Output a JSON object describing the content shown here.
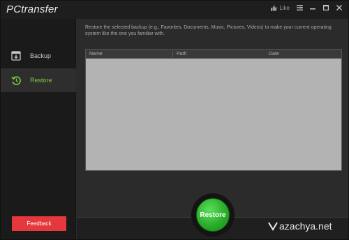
{
  "app": {
    "title": "PCtransfer"
  },
  "titlebar": {
    "like_label": "Like"
  },
  "sidebar": {
    "items": [
      {
        "label": "Backup",
        "icon": "backup-icon"
      },
      {
        "label": "Restore",
        "icon": "restore-icon"
      }
    ],
    "feedback_label": "Feedback"
  },
  "main": {
    "description": "Restore the selected backup (e.g., Favorites, Documents, Music, Pictures, Videos) to make your current operating system like the one you familiar with.",
    "table": {
      "columns": [
        "Name",
        "Path",
        "Date"
      ],
      "rows": []
    },
    "restore_label": "Restore"
  },
  "watermark": {
    "text": "azachya.net"
  },
  "colors": {
    "accent_green": "#7fcf3a",
    "feedback_red": "#e4383c",
    "restore_green": "#27a827"
  }
}
